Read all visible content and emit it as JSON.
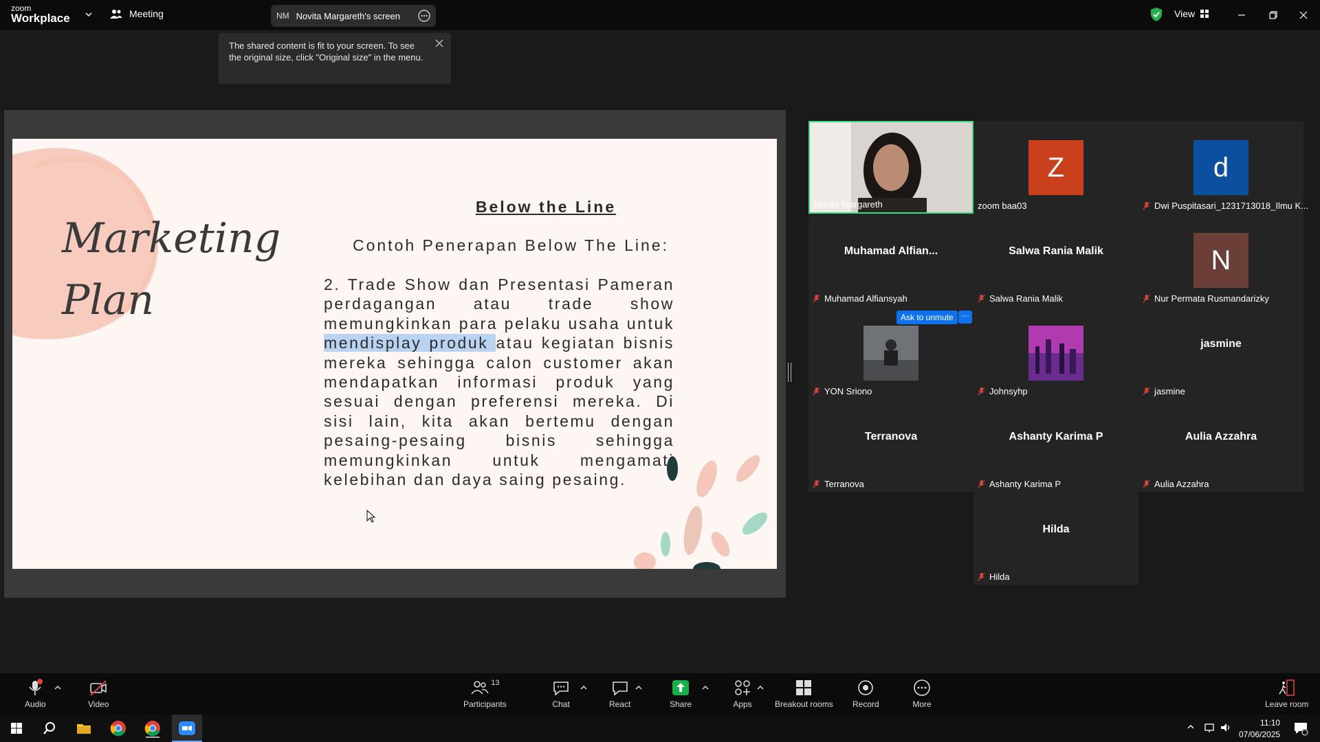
{
  "titlebar": {
    "logo_line1": "zoom",
    "logo_line2": "Workplace",
    "meeting_label": "Meeting",
    "share_initials": "NM",
    "share_label": "Novita Margareth's screen",
    "view_label": "View"
  },
  "toast": {
    "text": "The shared content is fit to your screen. To see the original size, click \"Original size\" in the menu."
  },
  "slide": {
    "left_title": [
      "Marketing",
      "Plan"
    ],
    "title": "Below the Line",
    "subtitle": "Contoh Penerapan Below The Line:",
    "body_before": "2. Trade Show dan Presentasi Pameran perdagangan atau trade show memungkinkan para pelaku usaha untuk ",
    "body_highlight": "mendisplay produk ",
    "body_after": "atau kegiatan bisnis mereka sehingga calon customer akan mendapatkan informasi produk yang sesuai dengan preferensi mereka. Di sisi lain, kita akan bertemu dengan pesaing-pesaing bisnis sehingga memungkinkan untuk mengamati kelebihan dan daya saing pesaing."
  },
  "gallery": {
    "ask_to_unmute": "Ask to unmute",
    "more": "···",
    "tiles": [
      {
        "name": "Novita Margareth",
        "big": "",
        "avatar": "",
        "muted": false
      },
      {
        "name": "zoom baa03",
        "big": "",
        "avatar": "Z",
        "avatar_color": "#c8401c",
        "muted": false
      },
      {
        "name": "Dwi Puspitasari_1231713018_Ilmu K...",
        "big": "",
        "avatar": "d",
        "avatar_color": "#0c4f9e",
        "muted": true
      },
      {
        "name": "Muhamad Alfiansyah",
        "big": "Muhamad  Alfian...",
        "avatar": "",
        "muted": true
      },
      {
        "name": "Salwa Rania Malik",
        "big": "Salwa Rania Malik",
        "avatar": "",
        "muted": true
      },
      {
        "name": "Nur Permata Rusmandarizky",
        "big": "",
        "avatar": "N",
        "avatar_color": "#6b3f38",
        "muted": true
      },
      {
        "name": "YON Sriono",
        "big": "",
        "avatar": "",
        "muted": true
      },
      {
        "name": "Johnsyhp",
        "big": "",
        "avatar": "",
        "muted": true
      },
      {
        "name": "jasmine",
        "big": "jasmine",
        "avatar": "",
        "muted": true
      },
      {
        "name": "Terranova",
        "big": "Terranova",
        "avatar": "",
        "muted": true
      },
      {
        "name": "Ashanty Karima P",
        "big": "Ashanty Karima P",
        "avatar": "",
        "muted": true
      },
      {
        "name": "Aulia Azzahra",
        "big": "Aulia Azzahra",
        "avatar": "",
        "muted": true
      },
      {
        "name": "Hilda",
        "big": "Hilda",
        "avatar": "",
        "muted": true
      }
    ]
  },
  "toolbar": {
    "audio": "Audio",
    "video": "Video",
    "participants": "Participants",
    "participants_count": "13",
    "chat": "Chat",
    "react": "React",
    "share": "Share",
    "apps": "Apps",
    "breakout": "Breakout rooms",
    "record": "Record",
    "more": "More",
    "leave": "Leave room"
  },
  "taskbar": {
    "time": "11:10",
    "date": "07/06/2025"
  },
  "colors": {
    "accent_blue": "#0e72ed",
    "active_speaker": "#3ddc84",
    "mute_red": "#e0453a",
    "share_green": "#18b04b"
  }
}
